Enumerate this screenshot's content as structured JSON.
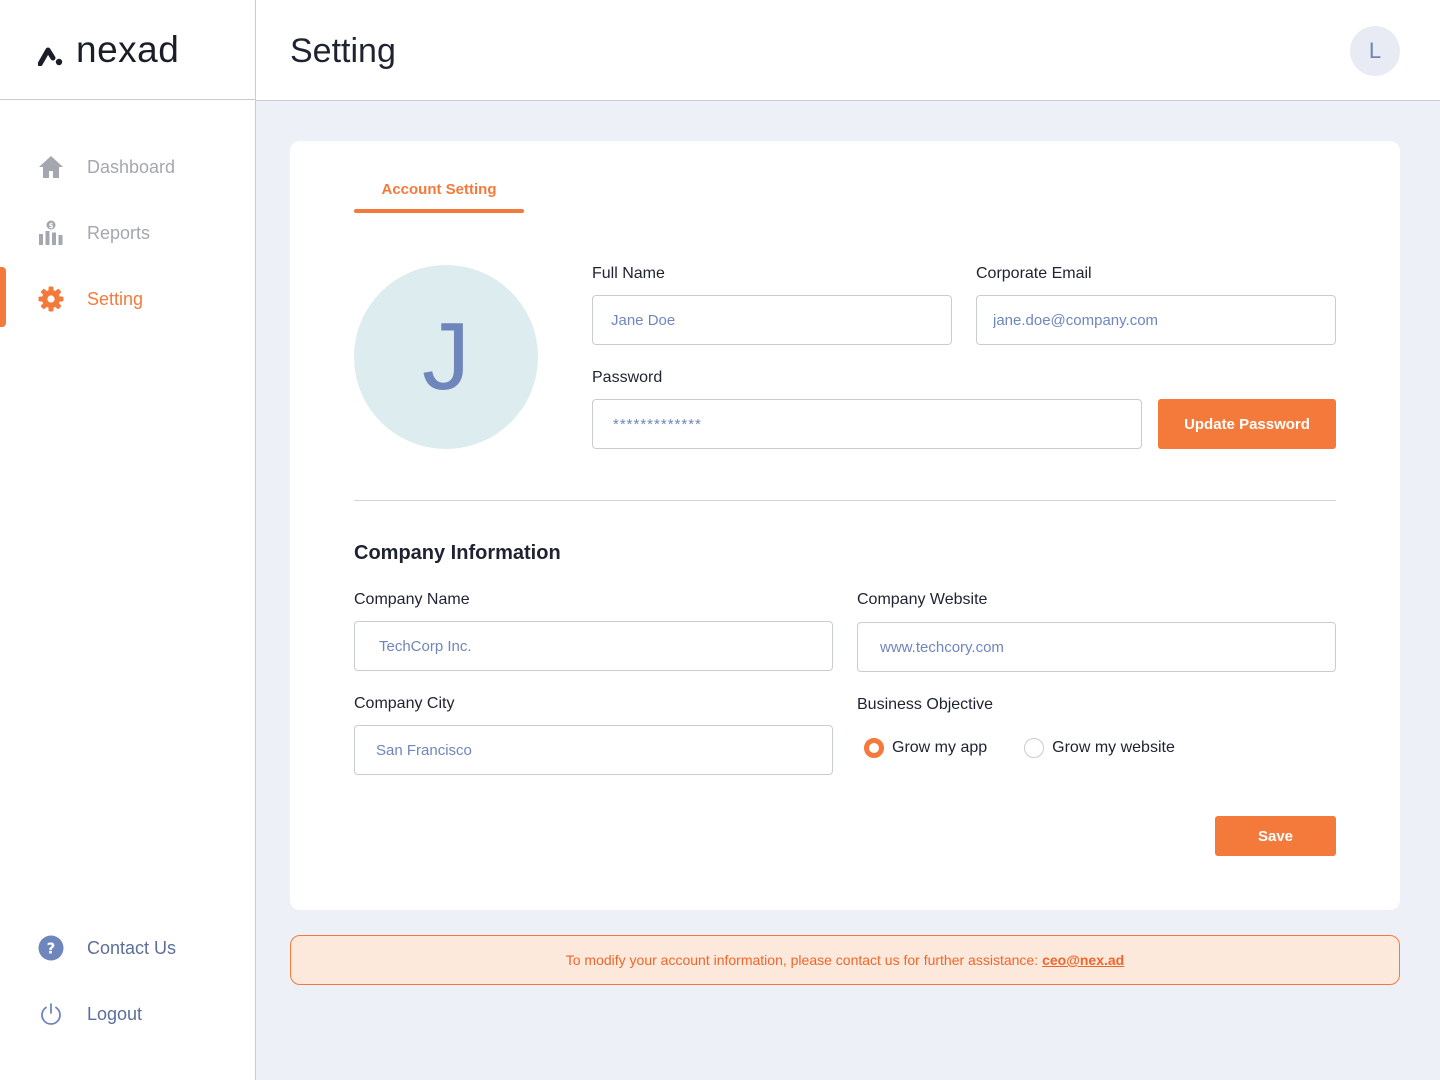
{
  "brand": {
    "name": "nexad"
  },
  "sidebar": {
    "items": [
      {
        "label": "Dashboard",
        "icon": "home-icon"
      },
      {
        "label": "Reports",
        "icon": "reports-icon"
      },
      {
        "label": "Setting",
        "icon": "gear-icon",
        "active": true
      }
    ],
    "bottom": [
      {
        "label": "Contact Us",
        "icon": "help-icon"
      },
      {
        "label": "Logout",
        "icon": "power-icon"
      }
    ]
  },
  "header": {
    "title": "Setting",
    "avatar_initial": "L"
  },
  "account": {
    "tab_label": "Account Setting",
    "avatar_initial": "J",
    "full_name_label": "Full Name",
    "full_name_value": "Jane Doe",
    "email_label": "Corporate Email",
    "email_value": "jane.doe@company.com",
    "password_label": "Password",
    "password_value": "*************",
    "update_password_label": "Update Password"
  },
  "company": {
    "section_title": "Company Information",
    "name_label": "Company Name",
    "name_value": "TechCorp Inc.",
    "website_label": "Company Website",
    "website_value": "www.techcory.com",
    "city_label": "Company City",
    "city_value": "San Francisco",
    "objective_label": "Business Objective",
    "objective_options": [
      {
        "label": "Grow my app",
        "selected": true
      },
      {
        "label": "Grow my website",
        "selected": false
      }
    ],
    "save_label": "Save"
  },
  "notice": {
    "text": "To modify your account information, please contact us for further assistance:",
    "email": "ceo@nex.ad"
  },
  "colors": {
    "accent": "#f47a3c",
    "muted_blue": "#6f86bd",
    "nav_gray": "#a4a7b0"
  }
}
